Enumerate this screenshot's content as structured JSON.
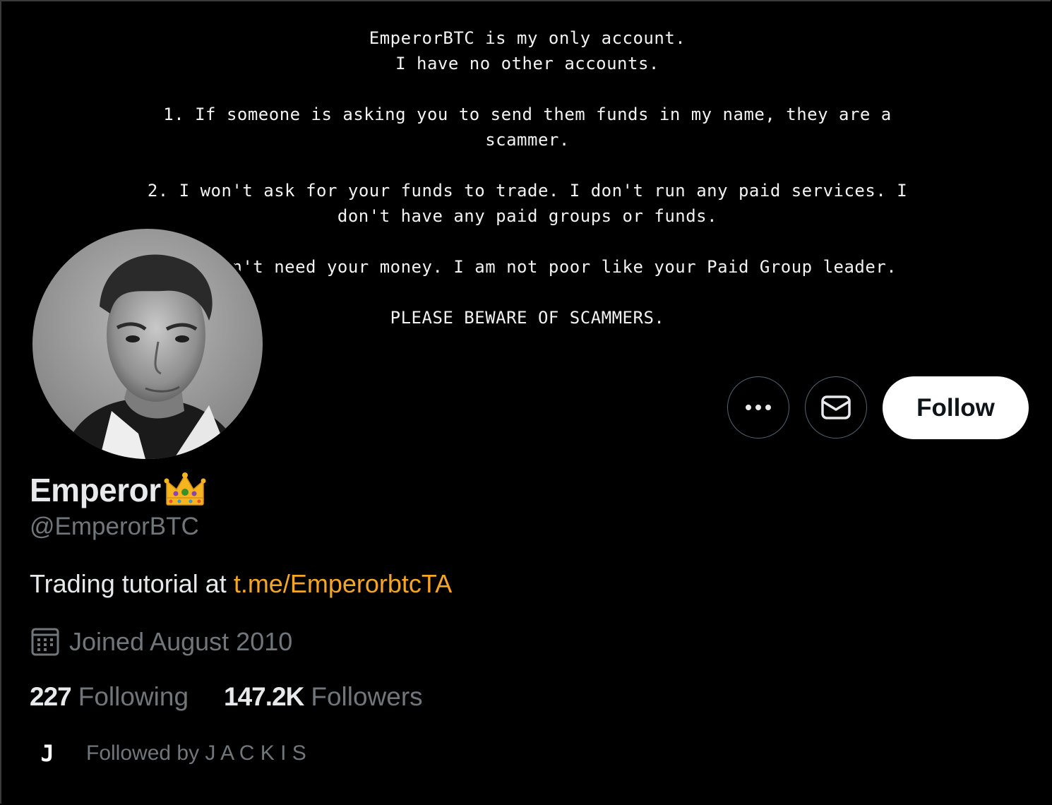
{
  "banner": {
    "lines": [
      "EmperorBTC is my only account.",
      "I have no other accounts.",
      "",
      "1. If someone is asking you to send them funds in my name, they are a",
      "scammer.",
      "",
      "2. I won't ask for your funds to trade. I don't run any paid services. I",
      "don't have any paid groups or funds.",
      "",
      "3. I don't need your money. I am not poor like your Paid Group leader.",
      "",
      "PLEASE BEWARE OF SCAMMERS."
    ]
  },
  "profile": {
    "display_name": "Emperor",
    "name_emoji_icon": "crown-icon",
    "handle": "@EmperorBTC",
    "bio_text": "Trading tutorial at ",
    "bio_link": "t.me/EmperorbtcTA",
    "joined_icon": "calendar-icon",
    "joined": "Joined August 2010",
    "following_count": "227",
    "following_label": "Following",
    "followers_count": "147.2K",
    "followers_label": "Followers",
    "followed_by_avatar": "J",
    "followed_by": "Followed by J A C K I S"
  },
  "actions": {
    "more_icon": "more-icon",
    "message_icon": "mail-icon",
    "follow_label": "Follow"
  },
  "colors": {
    "background": "#000000",
    "link": "#f5a623",
    "muted": "#71767b",
    "text": "#e7e9ea"
  }
}
